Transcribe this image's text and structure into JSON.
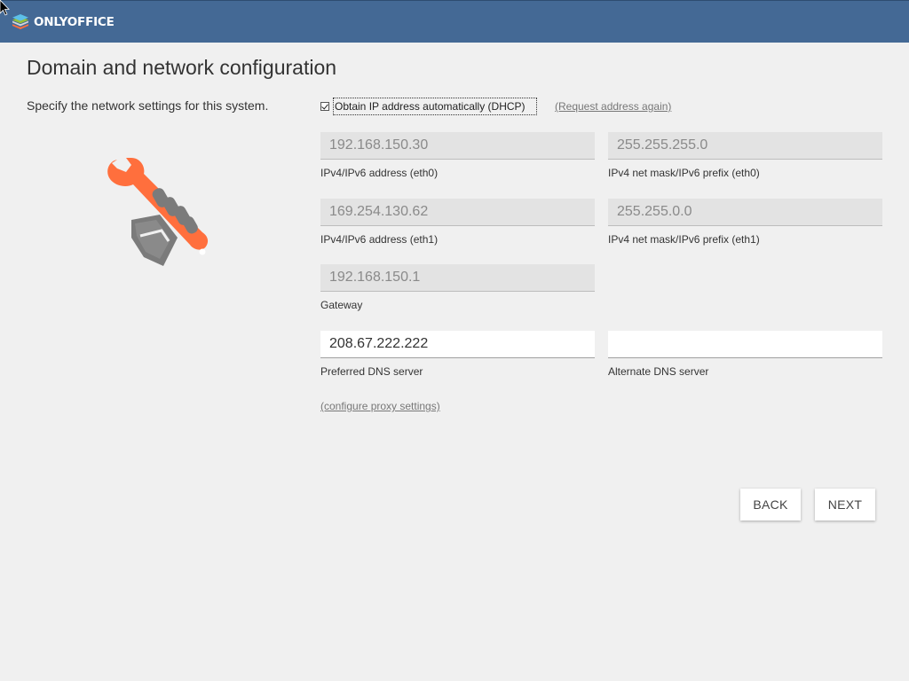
{
  "header": {
    "brand": "ONLYOFFICE",
    "logo_icon": "onlyoffice-layers-logo"
  },
  "page": {
    "title": "Domain and network configuration",
    "description": "Specify the network settings for this system.",
    "illustration_icon": "wrench-in-hand-icon"
  },
  "dhcp": {
    "label": "Obtain IP address automatically (DHCP)",
    "checked": true,
    "request_link": "(Request address again)"
  },
  "fields": {
    "ipv4_eth0": {
      "value": "192.168.150.30",
      "label": "IPv4/IPv6 address (eth0)"
    },
    "mask_eth0": {
      "value": "255.255.255.0",
      "label": "IPv4 net mask/IPv6 prefix (eth0)"
    },
    "ipv4_eth1": {
      "value": "169.254.130.62",
      "label": "IPv4/IPv6 address (eth1)"
    },
    "mask_eth1": {
      "value": "255.255.0.0",
      "label": "IPv4 net mask/IPv6 prefix (eth1)"
    },
    "gateway": {
      "value": "192.168.150.1",
      "label": "Gateway"
    },
    "dns_preferred": {
      "value": "208.67.222.222",
      "label": "Preferred DNS server"
    },
    "dns_alternate": {
      "value": "",
      "label": "Alternate DNS server"
    }
  },
  "proxy_link": "(configure proxy settings)",
  "buttons": {
    "back": "BACK",
    "next": "NEXT"
  },
  "colors": {
    "header_bg": "#446995",
    "page_bg": "#f0f0f0",
    "accent_orange": "#ff6f3d",
    "hand_gray": "#7b7b7b"
  }
}
